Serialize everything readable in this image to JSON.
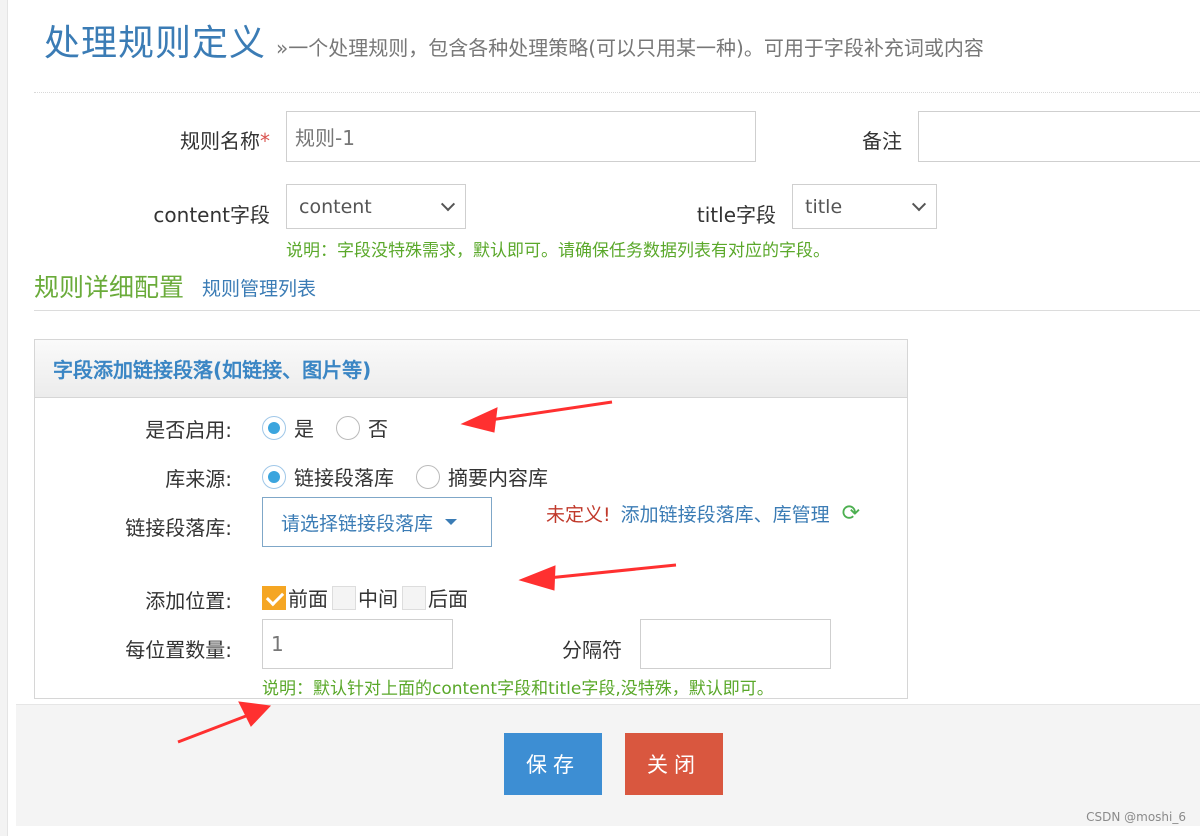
{
  "header": {
    "title": "处理规则定义",
    "subtitle": "»一个处理规则，包含各种处理策略(可以只用某一种)。可用于字段补充词或内容"
  },
  "form": {
    "rule_name_label": "规则名称",
    "required_mark": "*",
    "rule_name_value": "规则-1",
    "remark_label": "备注",
    "content_field_label": "content字段",
    "content_field_value": "content",
    "title_field_label": "title字段",
    "title_field_value": "title",
    "field_hint": "说明：字段没特殊需求，默认即可。请确保任务数据列表有对应的字段。"
  },
  "section": {
    "title": "规则详细配置",
    "link": "规则管理列表"
  },
  "panel": {
    "heading": "字段添加链接段落(如链接、图片等)",
    "enable_label": "是否启用:",
    "enable_yes": "是",
    "enable_no": "否",
    "source_label": "库来源:",
    "source_opt1": "链接段落库",
    "source_opt2": "摘要内容库",
    "lib_label": "链接段落库:",
    "lib_placeholder": "请选择链接段落库",
    "undefined_text": "未定义!",
    "undefined_links": "添加链接段落库、库管理",
    "position_label": "添加位置:",
    "pos_front": "前面",
    "pos_middle": "中间",
    "pos_back": "后面",
    "count_label": "每位置数量:",
    "count_value": "1",
    "separator_label": "分隔符",
    "panel_hint": "说明：默认针对上面的content字段和title字段,没特殊，默认即可。"
  },
  "footer": {
    "save": "保存",
    "close": "关闭"
  },
  "watermark": "CSDN @moshi_6",
  "colors": {
    "accent_blue": "#3b7cb5",
    "hint_green": "#5aa82a",
    "save_btn": "#3d8ed3",
    "close_btn": "#d9573f",
    "checkbox_on": "#f5a623",
    "arrow_red": "#ff3030"
  }
}
